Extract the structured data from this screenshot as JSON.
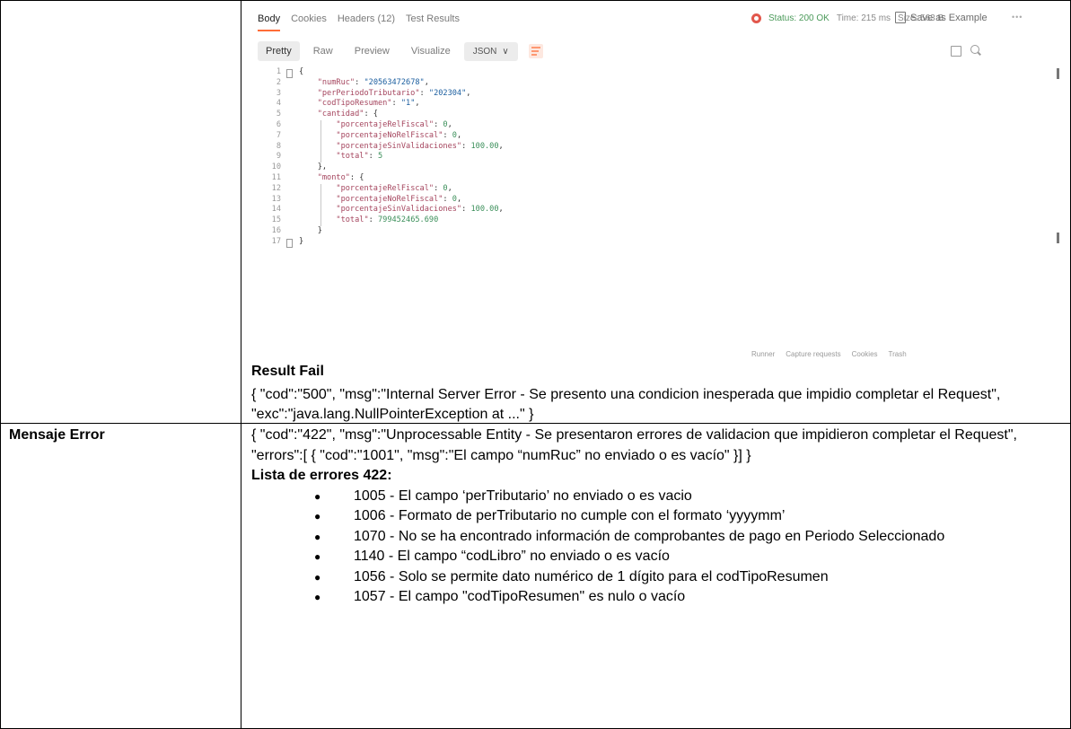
{
  "postman": {
    "tabs": [
      "Body",
      "Cookies",
      "Headers (12)",
      "Test Results"
    ],
    "status": "Status: 200 OK",
    "time": "Time: 215 ms",
    "size": "Size: 563 B",
    "save_label": "Save as Example",
    "more": "•••",
    "toolbar": {
      "pretty": "Pretty",
      "raw": "Raw",
      "preview": "Preview",
      "visualize": "Visualize",
      "format": "JSON",
      "chevron": "∨"
    },
    "code_lines": [
      "{",
      "    \"numRuc\": \"20563472678\",",
      "    \"perPeriodoTributario\": \"202304\",",
      "    \"codTipoResumen\": \"1\",",
      "    \"cantidad\": {",
      "        \"porcentajeRelFiscal\": 0,",
      "        \"porcentajeNoRelFiscal\": 0,",
      "        \"porcentajeSinValidaciones\": 100.00,",
      "        \"total\": 5",
      "    },",
      "    \"monto\": {",
      "        \"porcentajeRelFiscal\": 0,",
      "        \"porcentajeNoRelFiscal\": 0,",
      "        \"porcentajeSinValidaciones\": 100.00,",
      "        \"total\": 799452465.690",
      "    }",
      "}"
    ],
    "footer": [
      "Runner",
      "Capture requests",
      "Cookies",
      "Trash"
    ]
  },
  "result_fail": {
    "title": "Result Fail",
    "body": "{ \"cod\":\"500\", \"msg\":\"Internal Server Error - Se presento una condicion inesperada que impidio completar el Request\", \"exc\":\"java.lang.NullPointerException at ...\" }"
  },
  "mensaje_error": {
    "label": "Mensaje Error",
    "body": "{ \"cod\":\"422\", \"msg\":\"Unprocessable Entity - Se presentaron errores de validacion que impidieron completar el Request\", \"errors\":[ { \"cod\":\"1001\", \"msg\":\"El campo “numRuc” no enviado o es vacío\" }] }",
    "list_title": "Lista de errores 422:",
    "items": [
      "1005 - El campo ‘perTributario’ no enviado o es vacio",
      "1006 - Formato de perTributario no cumple con el formato ‘yyyymm’",
      "1070 - No se ha encontrado información de comprobantes de pago en Periodo Seleccionado",
      "1140 - El campo “codLibro” no enviado o es vacío",
      "1056 - Solo se permite dato numérico de 1 dígito para el codTipoResumen",
      "1057 - El campo \"codTipoResumen\" es nulo o vacío"
    ]
  }
}
